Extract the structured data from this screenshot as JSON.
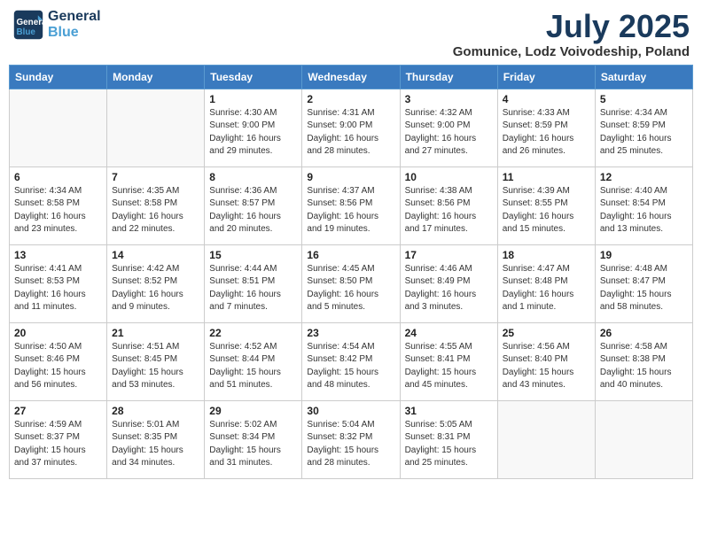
{
  "logo": {
    "line1": "General",
    "line2": "Blue"
  },
  "title": "July 2025",
  "subtitle": "Gomunice, Lodz Voivodeship, Poland",
  "days_of_week": [
    "Sunday",
    "Monday",
    "Tuesday",
    "Wednesday",
    "Thursday",
    "Friday",
    "Saturday"
  ],
  "weeks": [
    [
      {
        "day": "",
        "info": ""
      },
      {
        "day": "",
        "info": ""
      },
      {
        "day": "1",
        "info": "Sunrise: 4:30 AM\nSunset: 9:00 PM\nDaylight: 16 hours and 29 minutes."
      },
      {
        "day": "2",
        "info": "Sunrise: 4:31 AM\nSunset: 9:00 PM\nDaylight: 16 hours and 28 minutes."
      },
      {
        "day": "3",
        "info": "Sunrise: 4:32 AM\nSunset: 9:00 PM\nDaylight: 16 hours and 27 minutes."
      },
      {
        "day": "4",
        "info": "Sunrise: 4:33 AM\nSunset: 8:59 PM\nDaylight: 16 hours and 26 minutes."
      },
      {
        "day": "5",
        "info": "Sunrise: 4:34 AM\nSunset: 8:59 PM\nDaylight: 16 hours and 25 minutes."
      }
    ],
    [
      {
        "day": "6",
        "info": "Sunrise: 4:34 AM\nSunset: 8:58 PM\nDaylight: 16 hours and 23 minutes."
      },
      {
        "day": "7",
        "info": "Sunrise: 4:35 AM\nSunset: 8:58 PM\nDaylight: 16 hours and 22 minutes."
      },
      {
        "day": "8",
        "info": "Sunrise: 4:36 AM\nSunset: 8:57 PM\nDaylight: 16 hours and 20 minutes."
      },
      {
        "day": "9",
        "info": "Sunrise: 4:37 AM\nSunset: 8:56 PM\nDaylight: 16 hours and 19 minutes."
      },
      {
        "day": "10",
        "info": "Sunrise: 4:38 AM\nSunset: 8:56 PM\nDaylight: 16 hours and 17 minutes."
      },
      {
        "day": "11",
        "info": "Sunrise: 4:39 AM\nSunset: 8:55 PM\nDaylight: 16 hours and 15 minutes."
      },
      {
        "day": "12",
        "info": "Sunrise: 4:40 AM\nSunset: 8:54 PM\nDaylight: 16 hours and 13 minutes."
      }
    ],
    [
      {
        "day": "13",
        "info": "Sunrise: 4:41 AM\nSunset: 8:53 PM\nDaylight: 16 hours and 11 minutes."
      },
      {
        "day": "14",
        "info": "Sunrise: 4:42 AM\nSunset: 8:52 PM\nDaylight: 16 hours and 9 minutes."
      },
      {
        "day": "15",
        "info": "Sunrise: 4:44 AM\nSunset: 8:51 PM\nDaylight: 16 hours and 7 minutes."
      },
      {
        "day": "16",
        "info": "Sunrise: 4:45 AM\nSunset: 8:50 PM\nDaylight: 16 hours and 5 minutes."
      },
      {
        "day": "17",
        "info": "Sunrise: 4:46 AM\nSunset: 8:49 PM\nDaylight: 16 hours and 3 minutes."
      },
      {
        "day": "18",
        "info": "Sunrise: 4:47 AM\nSunset: 8:48 PM\nDaylight: 16 hours and 1 minute."
      },
      {
        "day": "19",
        "info": "Sunrise: 4:48 AM\nSunset: 8:47 PM\nDaylight: 15 hours and 58 minutes."
      }
    ],
    [
      {
        "day": "20",
        "info": "Sunrise: 4:50 AM\nSunset: 8:46 PM\nDaylight: 15 hours and 56 minutes."
      },
      {
        "day": "21",
        "info": "Sunrise: 4:51 AM\nSunset: 8:45 PM\nDaylight: 15 hours and 53 minutes."
      },
      {
        "day": "22",
        "info": "Sunrise: 4:52 AM\nSunset: 8:44 PM\nDaylight: 15 hours and 51 minutes."
      },
      {
        "day": "23",
        "info": "Sunrise: 4:54 AM\nSunset: 8:42 PM\nDaylight: 15 hours and 48 minutes."
      },
      {
        "day": "24",
        "info": "Sunrise: 4:55 AM\nSunset: 8:41 PM\nDaylight: 15 hours and 45 minutes."
      },
      {
        "day": "25",
        "info": "Sunrise: 4:56 AM\nSunset: 8:40 PM\nDaylight: 15 hours and 43 minutes."
      },
      {
        "day": "26",
        "info": "Sunrise: 4:58 AM\nSunset: 8:38 PM\nDaylight: 15 hours and 40 minutes."
      }
    ],
    [
      {
        "day": "27",
        "info": "Sunrise: 4:59 AM\nSunset: 8:37 PM\nDaylight: 15 hours and 37 minutes."
      },
      {
        "day": "28",
        "info": "Sunrise: 5:01 AM\nSunset: 8:35 PM\nDaylight: 15 hours and 34 minutes."
      },
      {
        "day": "29",
        "info": "Sunrise: 5:02 AM\nSunset: 8:34 PM\nDaylight: 15 hours and 31 minutes."
      },
      {
        "day": "30",
        "info": "Sunrise: 5:04 AM\nSunset: 8:32 PM\nDaylight: 15 hours and 28 minutes."
      },
      {
        "day": "31",
        "info": "Sunrise: 5:05 AM\nSunset: 8:31 PM\nDaylight: 15 hours and 25 minutes."
      },
      {
        "day": "",
        "info": ""
      },
      {
        "day": "",
        "info": ""
      }
    ]
  ]
}
